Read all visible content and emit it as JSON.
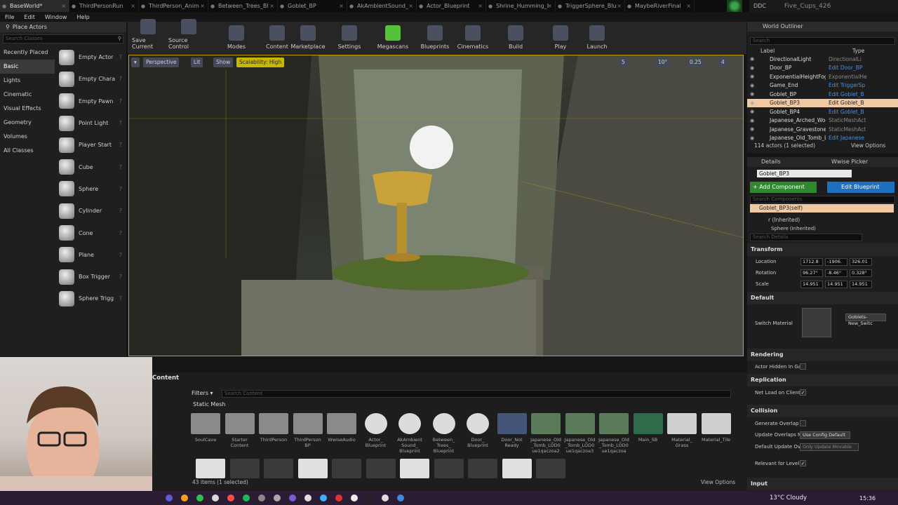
{
  "tabs": [
    {
      "label": "BaseWorld*",
      "active": true
    },
    {
      "label": "ThirdPersonRun"
    },
    {
      "label": "ThirdPerson_Anim"
    },
    {
      "label": "Between_Trees_Bl"
    },
    {
      "label": "Goblet_BP"
    },
    {
      "label": "AkAmbientSound_"
    },
    {
      "label": "Actor_Blueprint"
    },
    {
      "label": "Shrine_Humming_I"
    },
    {
      "label": "TriggerSphere_Blu"
    },
    {
      "label": "MaybeRiverFinal"
    }
  ],
  "project": {
    "ddc": "DDC",
    "name": "Five_Cups_426"
  },
  "menu": [
    "File",
    "Edit",
    "Window",
    "Help"
  ],
  "place_actors": {
    "title": "Place Actors",
    "search_placeholder": "Search Classes",
    "categories": [
      "Recently Placed",
      "Basic",
      "Lights",
      "Cinematic",
      "Visual Effects",
      "Geometry",
      "Volumes",
      "All Classes"
    ],
    "items": [
      "Empty Actor",
      "Empty Chara",
      "Empty Pawn",
      "Point Light",
      "Player Start",
      "Cube",
      "Sphere",
      "Cylinder",
      "Cone",
      "Plane",
      "Box Trigger",
      "Sphere Trigg"
    ]
  },
  "toolbar": [
    {
      "label": "Save Current",
      "icon": "save-icon"
    },
    {
      "label": "Source Control",
      "icon": "source-control-icon"
    },
    {
      "label": "Modes",
      "icon": "modes-icon"
    },
    {
      "label": "Content",
      "icon": "content-icon"
    },
    {
      "label": "Marketplace",
      "icon": "marketplace-icon"
    },
    {
      "label": "Settings",
      "icon": "settings-icon"
    },
    {
      "label": "Megascans",
      "icon": "megascans-icon"
    },
    {
      "label": "Blueprints",
      "icon": "blueprints-icon"
    },
    {
      "label": "Cinematics",
      "icon": "cinematics-icon"
    },
    {
      "label": "Build",
      "icon": "build-icon"
    },
    {
      "label": "Play",
      "icon": "play-icon"
    },
    {
      "label": "Launch",
      "icon": "launch-icon"
    }
  ],
  "viewport": {
    "perspective": "Perspective",
    "lit": "Lit",
    "show": "Show",
    "scalability": "Scalability: High",
    "grid": "5",
    "angle": "10°",
    "scale": "0.25",
    "cam": "4"
  },
  "outliner": {
    "title": "World Outliner",
    "search_placeholder": "Search",
    "col_label": "Label",
    "col_type": "Type",
    "rows": [
      {
        "label": "DirectionalLight",
        "type": "DirectionalLi",
        "link": false
      },
      {
        "label": "Door_BP",
        "type": "Edit Door_BP",
        "link": true
      },
      {
        "label": "ExponentialHeightFog",
        "type": "ExponentialHe",
        "link": false
      },
      {
        "label": "Game_End",
        "type": "Edit TriggerSp",
        "link": true
      },
      {
        "label": "Goblet_BP",
        "type": "Edit Goblet_B",
        "link": true
      },
      {
        "label": "Goblet_BP3",
        "type": "Edit Goblet_B",
        "link": true,
        "selected": true
      },
      {
        "label": "Goblet_BP4",
        "type": "Edit Goblet_B",
        "link": true
      },
      {
        "label": "Japanese_Arched_Wooden",
        "type": "StaticMeshAct",
        "link": false
      },
      {
        "label": "Japanese_Gravestone_LOD",
        "type": "StaticMeshAct",
        "link": false
      },
      {
        "label": "Japanese_Old_Tomb_LOD0",
        "type": "Edit Japanese",
        "link": true
      }
    ],
    "status": "114 actors (1 selected)",
    "view_options": "View Options"
  },
  "details": {
    "tab_details": "Details",
    "tab_wwise": "Wwise Picker",
    "actor_name": "Goblet_BP3",
    "add_component": "+ Add Component",
    "edit_blueprint": "Edit Blueprint",
    "search_components": "Search Components",
    "self": "Goblet_BP3(self)",
    "comp1": "r (Inherited)",
    "comp2": "Sphere (Inherited)",
    "search_details": "Search Details",
    "transform": "Transform",
    "location": "Location",
    "rotation": "Rotation",
    "scale": "Scale",
    "loc": [
      "1712.8",
      "-1906.",
      "326.01"
    ],
    "rot": [
      "96.27°",
      "-8.46°",
      "0.328°"
    ],
    "scl": [
      "14.951",
      "14.951",
      "14.951"
    ],
    "default": "Default",
    "switch_material": "Switch Material",
    "material_value": "Goblets-New_Switc",
    "rendering": "Rendering",
    "actor_hidden": "Actor Hidden In Ga",
    "replication": "Replication",
    "net_load": "Net Load on Client",
    "collision": "Collision",
    "gen_overlap": "Generate Overlap",
    "update_overlaps": "Update Overlaps M",
    "update_overlaps_val": "Use Config Default",
    "default_update": "Default Update Ov",
    "default_update_val": "Only Update Movable",
    "relevant": "Relevant for Level",
    "input": "Input"
  },
  "content": {
    "title": "Content",
    "filters": "Filters",
    "search_placeholder": "Search Content",
    "tag": "Static Mesh",
    "assets_row1": [
      "SoulCave",
      "Starter Content",
      "ThirdPerson",
      "ThirdPerson BP",
      "WwiseAudio",
      "Actor_ Blueprint",
      "AkAmbient Sound_ Blueprint",
      "Between_ Trees_ Blueprint",
      "Door_ Blueprint",
      "Door_Not Ready",
      "Japanese_Old _Tomb_LOD0 ue1qaczoa2",
      "Japanese_Old _Tomb_LOD0 ue1qaczoa3",
      "Japanese_Old _Tomb_LOD0 ue1qaczoa",
      "Main_SB",
      "Material_ Grass",
      "Material_Tile"
    ],
    "status": "43 items (1 selected)",
    "view_options": "View Options"
  },
  "taskbar": {
    "weather": "13°C Cloudy",
    "time": "15:36"
  }
}
